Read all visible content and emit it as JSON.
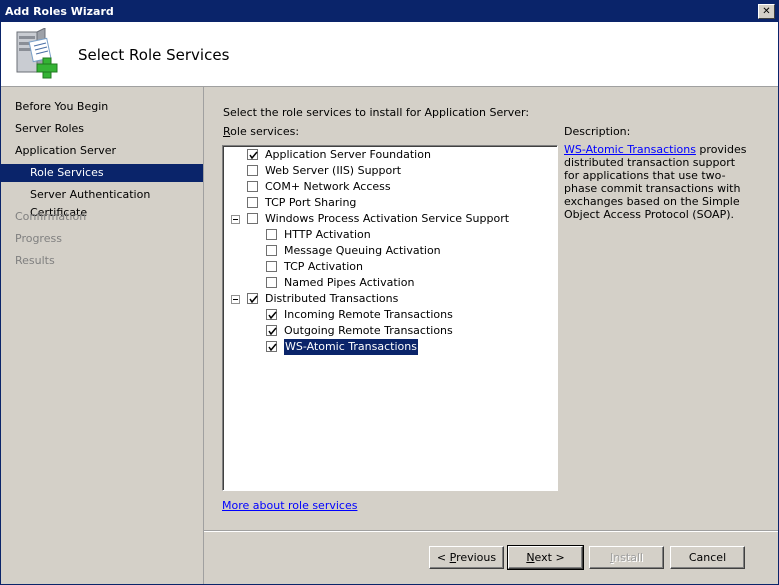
{
  "window": {
    "title": "Add Roles Wizard",
    "close_glyph": "✕"
  },
  "header": {
    "title": "Select Role Services",
    "icon": "server-add-icon"
  },
  "nav": {
    "items": [
      {
        "label": "Before You Begin",
        "state": "normal"
      },
      {
        "label": "Server Roles",
        "state": "normal"
      },
      {
        "label": "Application Server",
        "state": "normal"
      },
      {
        "label": "Role Services",
        "state": "active"
      },
      {
        "label": "Server Authentication Certificate",
        "state": "normal"
      },
      {
        "label": "Confirmation",
        "state": "disabled"
      },
      {
        "label": "Progress",
        "state": "disabled"
      },
      {
        "label": "Results",
        "state": "disabled"
      }
    ]
  },
  "main": {
    "intro": "Select the role services to install for Application Server:",
    "role_services_label_first": "R",
    "role_services_label_rest": "ole services:",
    "description_label": "Description:",
    "description_link": "WS-Atomic Transactions",
    "description_text": " provides distributed transaction support for applications that use two-phase commit transactions with exchanges based on the Simple Object Access Protocol (SOAP).",
    "more_link": "More about role services",
    "tree": [
      {
        "label": "Application Server Foundation",
        "checked": true,
        "level": 0
      },
      {
        "label": "Web Server (IIS) Support",
        "checked": false,
        "level": 0
      },
      {
        "label": "COM+ Network Access",
        "checked": false,
        "level": 0
      },
      {
        "label": "TCP Port Sharing",
        "checked": false,
        "level": 0
      },
      {
        "label": "Windows Process Activation Service Support",
        "checked": false,
        "level": 0,
        "expander": true
      },
      {
        "label": "HTTP Activation",
        "checked": false,
        "level": 1
      },
      {
        "label": "Message Queuing Activation",
        "checked": false,
        "level": 1
      },
      {
        "label": "TCP Activation",
        "checked": false,
        "level": 1
      },
      {
        "label": "Named Pipes Activation",
        "checked": false,
        "level": 1
      },
      {
        "label": "Distributed Transactions",
        "checked": true,
        "level": 0,
        "expander": true
      },
      {
        "label": "Incoming Remote Transactions",
        "checked": true,
        "level": 1
      },
      {
        "label": "Outgoing Remote Transactions",
        "checked": true,
        "level": 1
      },
      {
        "label": "WS-Atomic Transactions",
        "checked": true,
        "level": 1,
        "selected": true
      }
    ]
  },
  "buttons": {
    "previous_prefix": "< ",
    "previous_accel": "P",
    "previous_rest": "revious",
    "next_accel": "N",
    "next_rest": "ext >",
    "install_accel": "I",
    "install_rest": "nstall",
    "cancel": "Cancel"
  }
}
